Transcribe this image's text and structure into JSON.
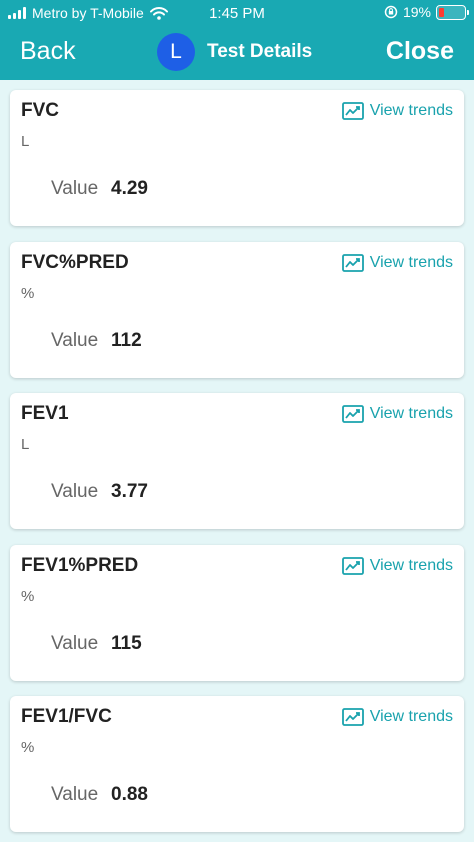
{
  "status_bar": {
    "carrier": "Metro by T-Mobile",
    "time": "1:45 PM",
    "battery": "19%"
  },
  "nav": {
    "back_label": "Back",
    "avatar_letter": "L",
    "title": "Test Details",
    "close_label": "Close"
  },
  "trends_label": "View trends",
  "value_label": "Value",
  "tests": [
    {
      "name": "FVC",
      "unit": "L",
      "value": "4.29"
    },
    {
      "name": "FVC%PRED",
      "unit": "%",
      "value": "112"
    },
    {
      "name": "FEV1",
      "unit": "L",
      "value": "3.77"
    },
    {
      "name": "FEV1%PRED",
      "unit": "%",
      "value": "115"
    },
    {
      "name": "FEV1/FVC",
      "unit": "%",
      "value": "0.88"
    }
  ],
  "colors": {
    "header": "#19a9b3",
    "accent": "#19a2ad",
    "avatar": "#1e5fe6",
    "background": "#e4f6f7"
  }
}
